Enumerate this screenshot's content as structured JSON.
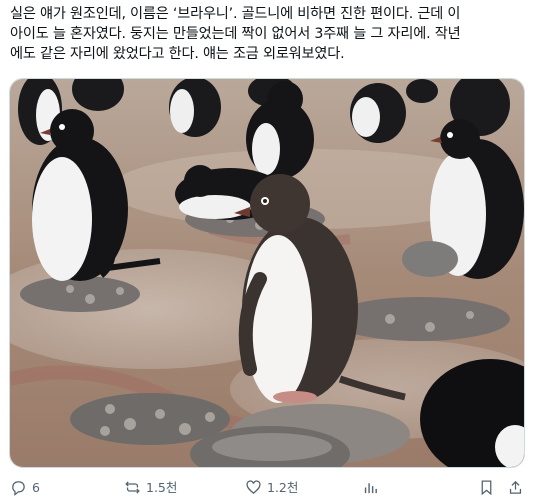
{
  "tweet": {
    "lines": [
      "실은 얘가 원조인데, 이름은 ‘브라우니’. 골드니에 비하면 진한 편이다. 근데 이",
      "아이도 늘 혼자였다. 둥지는 만들었는데 짝이 없어서 3주째 늘 그 자리에. 작년",
      "에도 같은 자리에 왔었다고 한다. 얘는 조금 외로워보였다."
    ]
  },
  "media": {
    "description_icon": "photo-penguins"
  },
  "actions": {
    "reply_count": "6",
    "repost_count": "1.5천",
    "like_count": "1.2천",
    "icons": [
      "reply-icon",
      "repost-icon",
      "like-icon",
      "views-icon",
      "bookmark-icon",
      "share-icon"
    ]
  },
  "colors": {
    "text": "#0f1419",
    "muted": "#536471",
    "border": "#cfd9de"
  }
}
